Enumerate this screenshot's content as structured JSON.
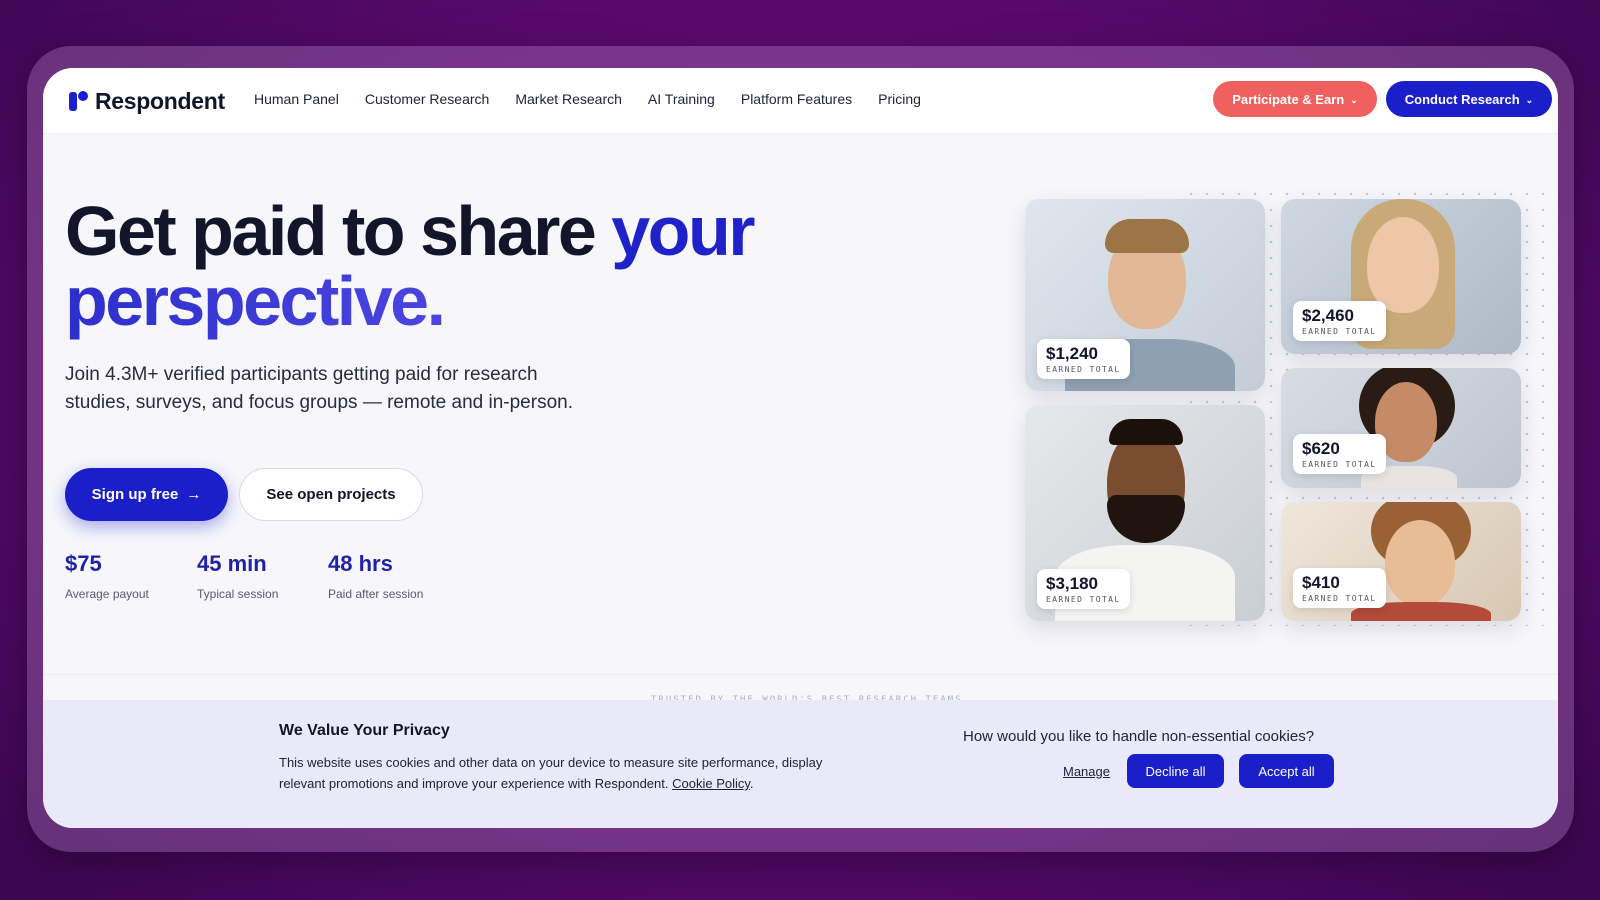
{
  "nav": {
    "logo_text": "Respondent",
    "links": [
      "Human Panel",
      "Customer Research",
      "Market Research",
      "AI Training",
      "Platform Features",
      "Pricing"
    ],
    "participate_label": "Participate & Earn",
    "conduct_label": "Conduct Research"
  },
  "hero": {
    "title_part1": "Get paid to share ",
    "title_accent1": "your",
    "title_accent2": "perspective.",
    "subtitle": "Join 4.3M+ verified participants getting paid for research studies, surveys, and focus groups — remote and in-person.",
    "signup_label": "Sign up free",
    "projects_label": "See open projects",
    "stats": [
      {
        "value": "$75",
        "label": "Average payout"
      },
      {
        "value": "45 min",
        "label": "Typical session"
      },
      {
        "value": "48 hrs",
        "label": "Paid after session"
      }
    ]
  },
  "cards": [
    {
      "amount": "$1,240",
      "label": "EARNED TOTAL"
    },
    {
      "amount": "$2,460",
      "label": "EARNED TOTAL"
    },
    {
      "amount": "$620",
      "label": "EARNED TOTAL"
    },
    {
      "amount": "$3,180",
      "label": "EARNED TOTAL"
    },
    {
      "amount": "$410",
      "label": "EARNED TOTAL"
    }
  ],
  "trusted_text": "TRUSTED BY THE WORLD'S BEST RESEARCH TEAMS",
  "cookie": {
    "title": "We Value Your Privacy",
    "text": "This website uses cookies and other data on your device to measure site performance, display relevant promotions and improve your experience with Respondent.",
    "policy_link": "Cookie Policy",
    "question": "How would you like to handle non-essential cookies?",
    "manage_label": "Manage",
    "decline_label": "Decline all",
    "accept_label": "Accept all"
  },
  "colors": {
    "brand_blue": "#1b1fc9",
    "coral": "#f0605e",
    "background_purple": "#5a0a6e"
  },
  "icons": {
    "arrow": "→",
    "chevron": "⌄"
  }
}
